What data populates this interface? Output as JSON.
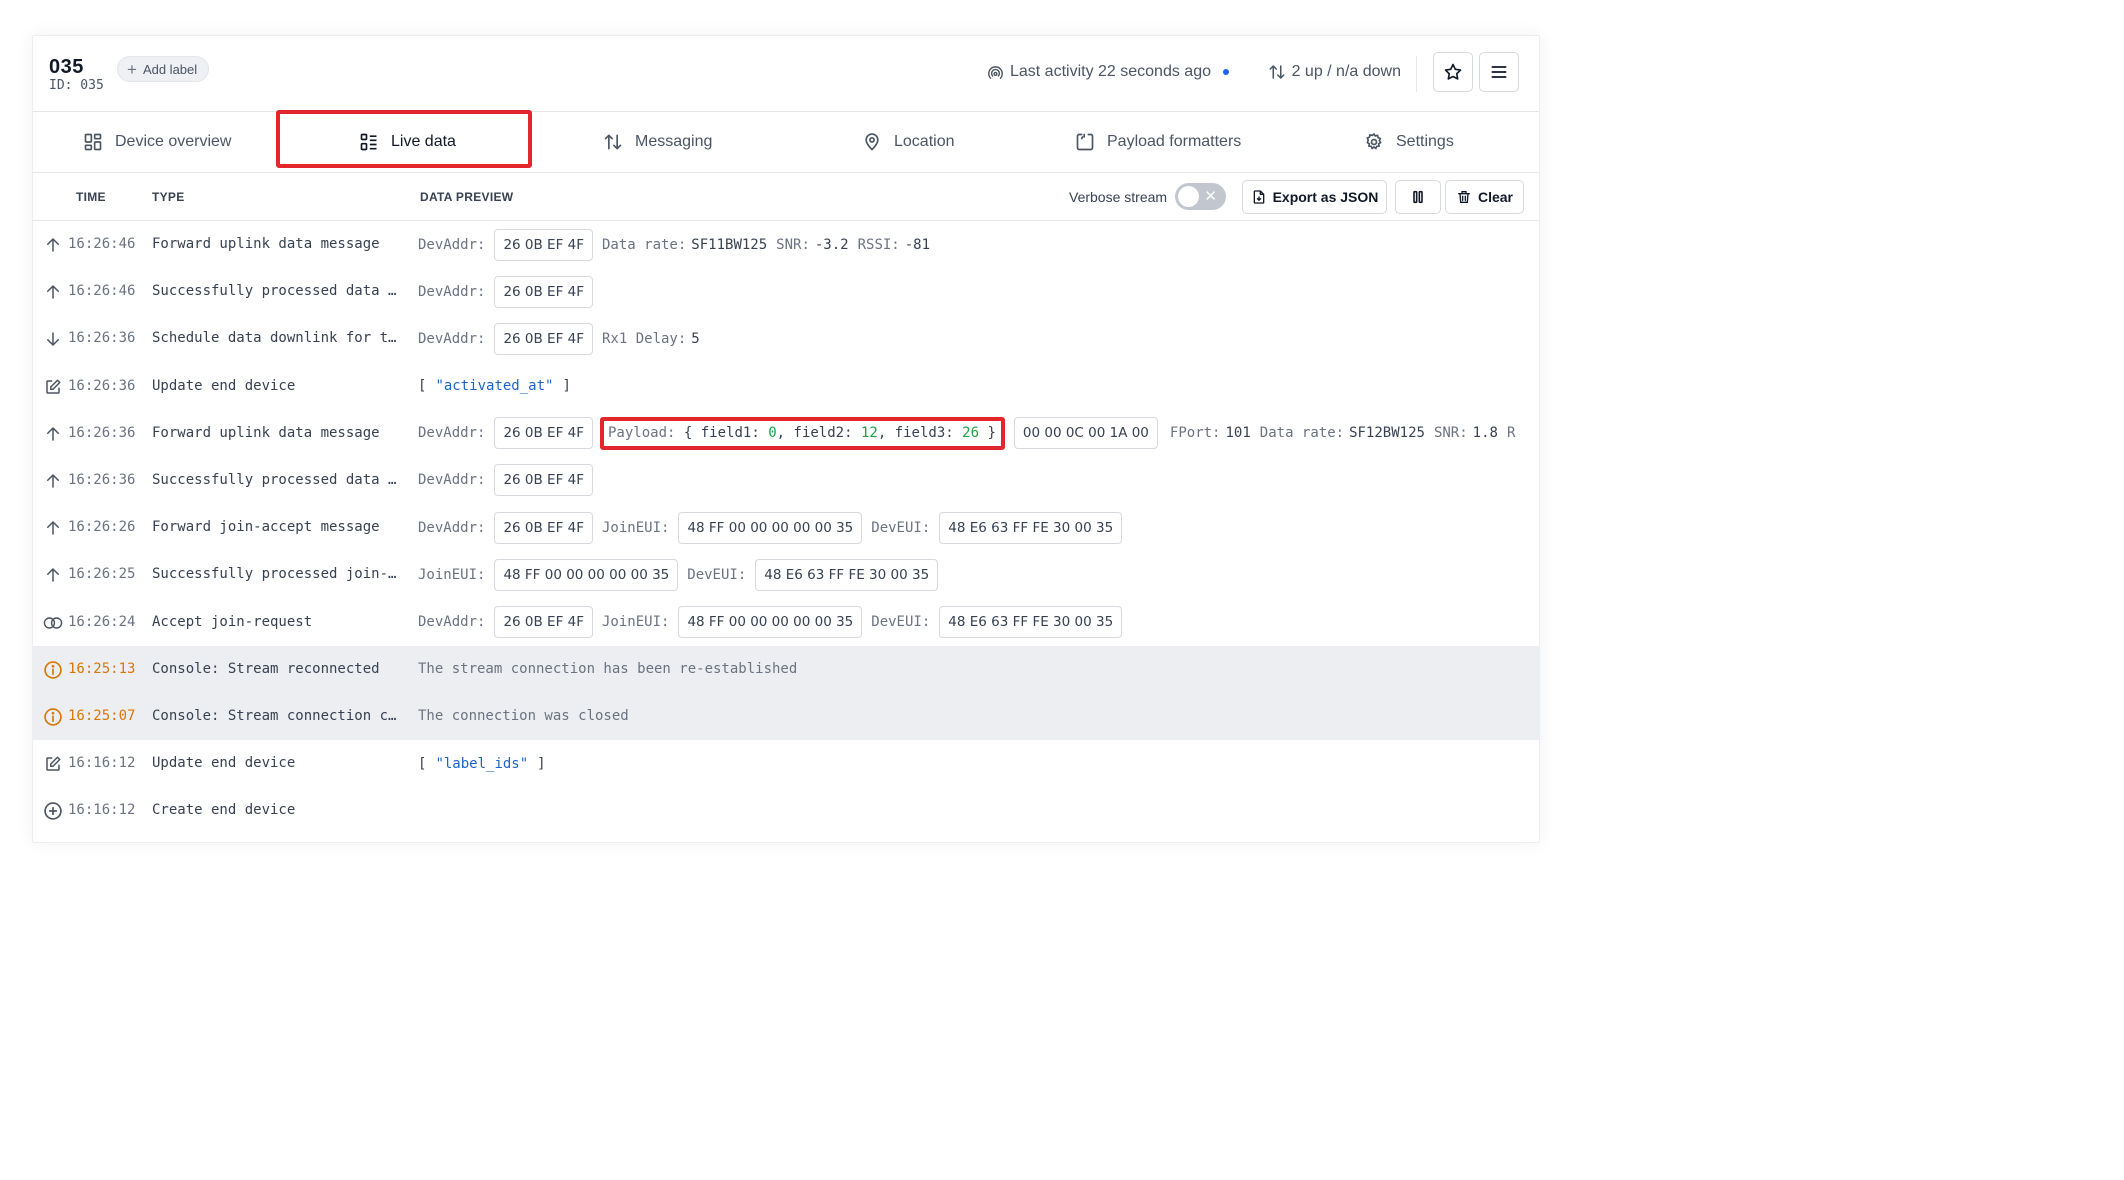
{
  "device": {
    "name": "035",
    "id_text": "ID: 035",
    "add_label": "Add label"
  },
  "header": {
    "last_activity": "Last activity 22 seconds ago",
    "traffic": "2 up / n/a down"
  },
  "tabs": [
    {
      "label": "Device overview",
      "icon": "grid-icon"
    },
    {
      "label": "Live data",
      "icon": "list-icon",
      "active": true
    },
    {
      "label": "Messaging",
      "icon": "arrows-updown-icon"
    },
    {
      "label": "Location",
      "icon": "location-pin-icon"
    },
    {
      "label": "Payload formatters",
      "icon": "code-bracket-icon"
    },
    {
      "label": "Settings",
      "icon": "gear-icon"
    }
  ],
  "table": {
    "col_time": "TIME",
    "col_type": "TYPE",
    "col_preview": "DATA PREVIEW",
    "verbose_label": "Verbose stream",
    "export_label": "Export as JSON",
    "clear_label": "Clear"
  },
  "colors": {
    "accent": "#1d64f2",
    "highlight": "#e3262b",
    "warning": "#d97706",
    "string": "#1d64c8",
    "number": "#22a044"
  },
  "rows": [
    {
      "icon": "arrow-up-icon",
      "time": "16:26:46",
      "type": "Forward uplink data message",
      "devaddr_label": "DevAddr:",
      "devaddr": "26 0B EF 4F",
      "rate_label": "Data rate:",
      "rate": "SF11BW125",
      "snr_label": "SNR:",
      "snr": "-3.2",
      "rssi_label": "RSSI:",
      "rssi": "-81"
    },
    {
      "icon": "arrow-up-icon",
      "time": "16:26:46",
      "type": "Successfully processed data …",
      "devaddr_label": "DevAddr:",
      "devaddr": "26 0B EF 4F"
    },
    {
      "icon": "arrow-down-icon",
      "time": "16:26:36",
      "type": "Schedule data downlink for t…",
      "devaddr_label": "DevAddr:",
      "devaddr": "26 0B EF 4F",
      "rx_label": "Rx1 Delay:",
      "rx": "5"
    },
    {
      "icon": "edit-icon",
      "time": "16:26:36",
      "type": "Update end device",
      "open": "[",
      "field": "\"activated_at\"",
      "close": "]"
    },
    {
      "icon": "arrow-up-icon",
      "time": "16:26:36",
      "type": "Forward uplink data message",
      "devaddr_label": "DevAddr:",
      "devaddr": "26 0B EF 4F",
      "payload_label": "Payload:",
      "brace_open": "{",
      "f1_label": "field1:",
      "f1": "0",
      "f2_label": "field2:",
      "f2": "12",
      "f3_label": "field3:",
      "f3": "26",
      "brace_close": "}",
      "raw": "00 00 0C 00 1A 00",
      "fport_label": "FPort:",
      "fport": "101",
      "rate_label": "Data rate:",
      "rate": "SF12BW125",
      "snr_label": "SNR:",
      "snr": "1.8",
      "tail": "R"
    },
    {
      "icon": "arrow-up-icon",
      "time": "16:26:36",
      "type": "Successfully processed data …",
      "devaddr_label": "DevAddr:",
      "devaddr": "26 0B EF 4F"
    },
    {
      "icon": "arrow-up-icon",
      "time": "16:26:26",
      "type": "Forward join-accept message",
      "devaddr_label": "DevAddr:",
      "devaddr": "26 0B EF 4F",
      "joineui_label": "JoinEUI:",
      "joineui": "48 FF 00 00 00 00 00 35",
      "deveui_label": "DevEUI:",
      "deveui": "48 E6 63 FF FE 30 00 35"
    },
    {
      "icon": "arrow-up-icon",
      "time": "16:26:25",
      "type": "Successfully processed join-…",
      "joineui_label": "JoinEUI:",
      "joineui": "48 FF 00 00 00 00 00 35",
      "deveui_label": "DevEUI:",
      "deveui": "48 E6 63 FF FE 30 00 35"
    },
    {
      "icon": "join-link-icon",
      "time": "16:26:24",
      "type": "Accept join-request",
      "devaddr_label": "DevAddr:",
      "devaddr": "26 0B EF 4F",
      "joineui_label": "JoinEUI:",
      "joineui": "48 FF 00 00 00 00 00 35",
      "deveui_label": "DevEUI:",
      "deveui": "48 E6 63 FF FE 30 00 35"
    },
    {
      "icon": "info-warning-icon",
      "time": "16:25:13",
      "type": "Console: Stream reconnected",
      "message": "The stream connection has been re-established"
    },
    {
      "icon": "info-warning-icon",
      "time": "16:25:07",
      "type": "Console: Stream connection c…",
      "message": "The connection was closed"
    },
    {
      "icon": "edit-icon",
      "time": "16:16:12",
      "type": "Update end device",
      "open": "[",
      "field": "\"label_ids\"",
      "close": "]"
    },
    {
      "icon": "plus-circle-icon",
      "time": "16:16:12",
      "type": "Create end device"
    }
  ]
}
